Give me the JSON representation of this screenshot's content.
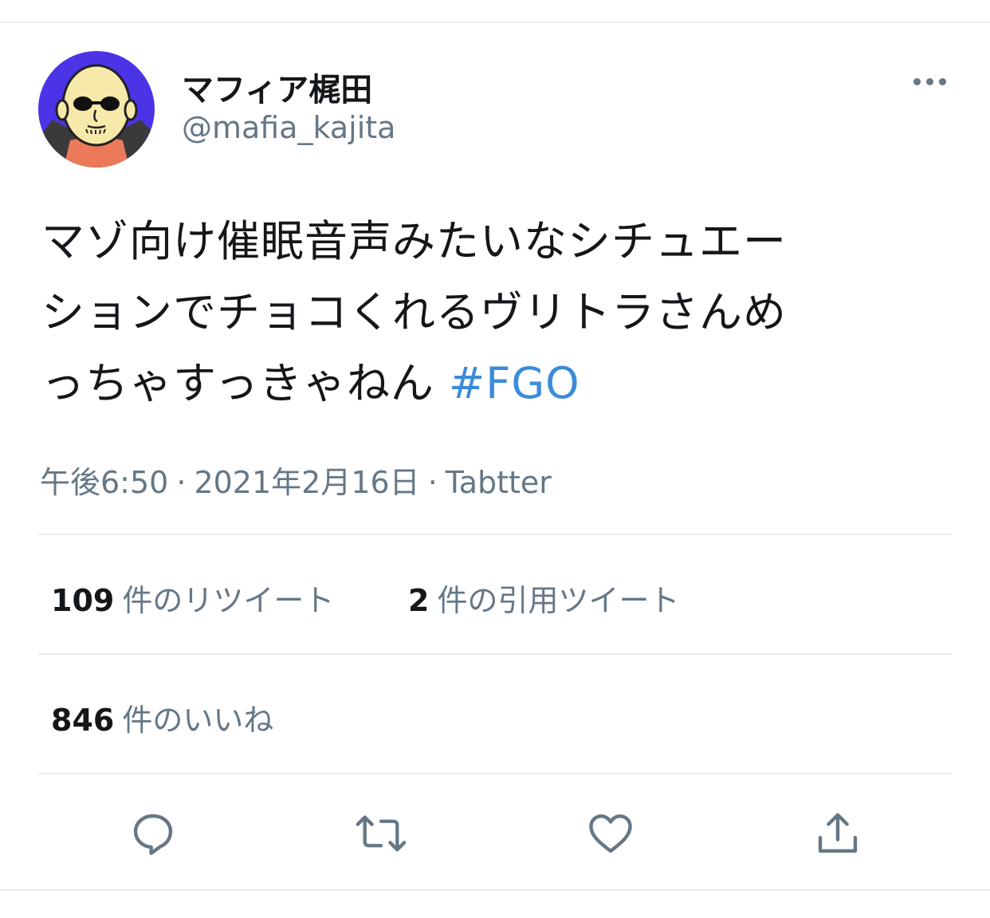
{
  "author": {
    "display_name": "マフィア梶田",
    "handle": "@mafia_kajita"
  },
  "tweet": {
    "text_lines": [
      "マゾ向け催眠音声みたいなシチュエー",
      "ションでチョコくれるヴリトラさんめ",
      "っちゃすっきゃねん "
    ],
    "hashtag": "#FGO"
  },
  "meta": {
    "time": "午後6:50",
    "separator": "·",
    "date": "2021年2月16日",
    "client": "Tabtter"
  },
  "stats": {
    "retweets": {
      "count": "109",
      "label": "件のリツイート"
    },
    "quotes": {
      "count": "2",
      "label": "件の引用ツイート"
    },
    "likes": {
      "count": "846",
      "label": "件のいいね"
    }
  },
  "icons": {
    "more": "more-horizontal-icon",
    "reply": "reply-icon",
    "retweet": "retweet-icon",
    "like": "heart-icon",
    "share": "share-icon"
  },
  "colors": {
    "hashtag": "#3b8bd9",
    "secondary_text": "#657786",
    "divider": "#e6ecf0",
    "avatar_background": "#4b33e6"
  }
}
